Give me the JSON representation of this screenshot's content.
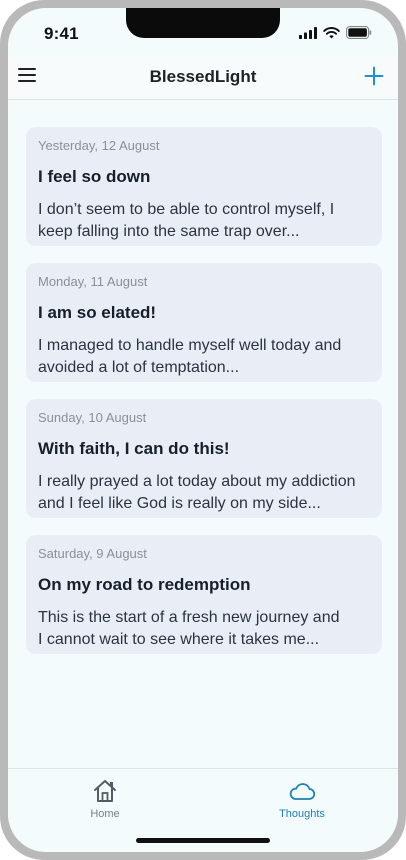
{
  "status_bar": {
    "time": "9:41"
  },
  "header": {
    "title": "BlessedLight"
  },
  "entries": [
    {
      "date": "Yesterday, 12 August",
      "title": "I feel so down",
      "body": "I don’t seem to be able to control myself, I\nkeep falling into the same trap over..."
    },
    {
      "date": "Monday, 11 August",
      "title": "I am so elated!",
      "body": "I managed to handle myself well today and\navoided a lot of temptation..."
    },
    {
      "date": "Sunday, 10 August",
      "title": "With faith, I can do this!",
      "body": "I really prayed a lot today about my addiction\nand I feel like God is really on my side..."
    },
    {
      "date": "Saturday, 9 August",
      "title": "On my road to redemption",
      "body": "This is the start of a fresh new journey and\nI cannot wait to see where it takes me..."
    }
  ],
  "tabs": {
    "home_label": "Home",
    "thoughts_label": "Thoughts",
    "active": "Thoughts"
  },
  "colors": {
    "accent": "#1f8fd6",
    "active_tab": "#1f7fb8",
    "card_bg": "#e9eef6",
    "screen_bg": "#f3fbfd"
  }
}
